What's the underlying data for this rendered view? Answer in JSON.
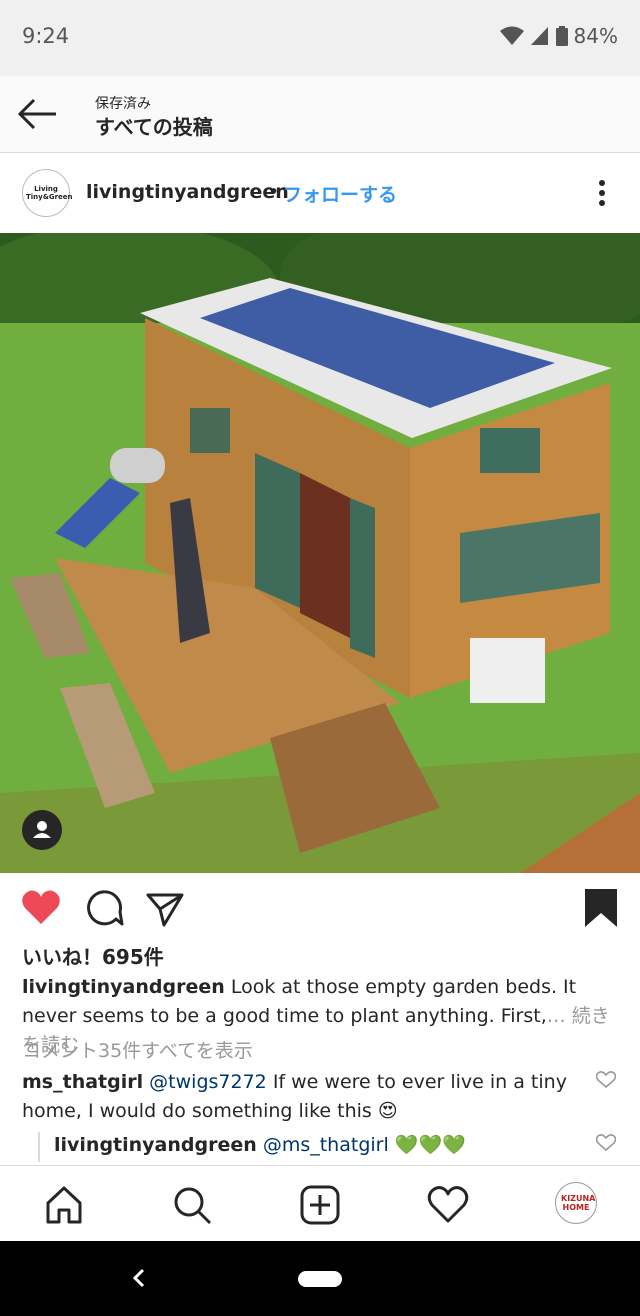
{
  "status_bar": {
    "time": "9:24",
    "battery": "84%"
  },
  "header": {
    "subtitle": "保存済み",
    "title": "すべての投稿"
  },
  "post": {
    "avatar_text": "Living Tiny&Green",
    "username": "livingtinyandgreen",
    "separator": "•",
    "follow_label": "フォローする",
    "likes": "いいね！695件",
    "caption_user": "livingtinyandgreen",
    "caption_text": "Look at those empty garden beds. It never seems to be a good time to plant anything. First,",
    "caption_more": "… 続きを読む",
    "view_all_comments": "コメント35件すべてを表示",
    "comments": [
      {
        "user": "ms_thatgirl",
        "mention": "@twigs7272",
        "text": "If we were to ever live in a tiny home, I would do something like this 😍"
      },
      {
        "user": "livingtinyandgreen",
        "mention": "@ms_thatgirl",
        "text": "💚💚💚"
      }
    ]
  },
  "nav": {
    "profile_avatar_text": "KIZUNA HOME"
  },
  "colors": {
    "like_red": "#ed4956",
    "link_blue": "#3897f0",
    "mention_blue": "#003569"
  }
}
